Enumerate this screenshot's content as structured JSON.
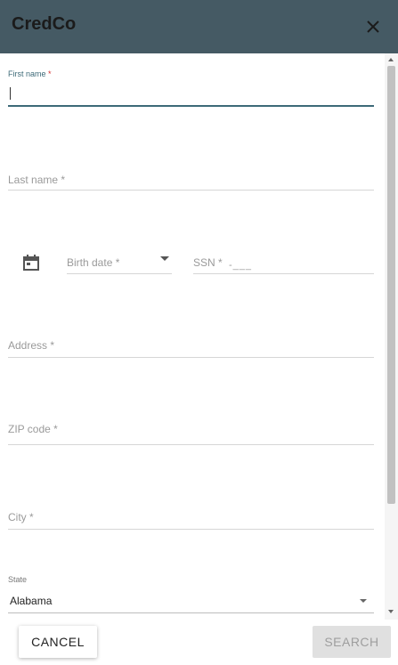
{
  "app": {
    "title": "CredCo"
  },
  "form": {
    "first_name": {
      "label": "First name",
      "required_mark": "*",
      "value": ""
    },
    "last_name": {
      "label": "Last name",
      "required_mark": "*"
    },
    "birth_date": {
      "label": "Birth date",
      "required_mark": "*"
    },
    "ssn": {
      "label": "SSN",
      "required_mark": "*",
      "mask": "-___"
    },
    "address": {
      "label": "Address",
      "required_mark": "*"
    },
    "zip": {
      "label": "ZIP code",
      "required_mark": "*"
    },
    "city": {
      "label": "City",
      "required_mark": "*"
    },
    "state": {
      "label": "State",
      "value": "Alabama"
    }
  },
  "actions": {
    "cancel": "CANCEL",
    "search": "SEARCH"
  },
  "colors": {
    "appbar": "#455a64",
    "focus": "#3d6a78",
    "required_focus": "#d32f2f"
  },
  "icons": [
    "close-icon",
    "calendar-icon",
    "dropdown-caret-icon"
  ]
}
